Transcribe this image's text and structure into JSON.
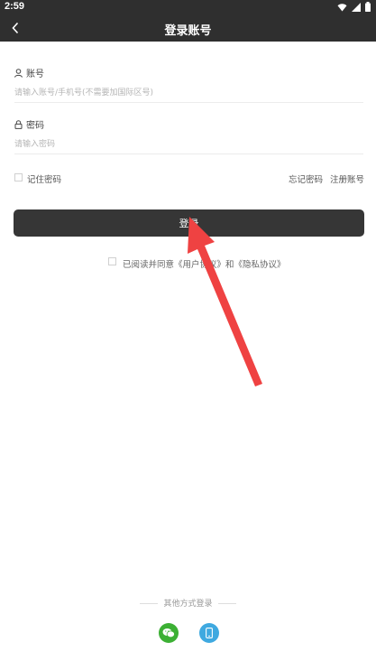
{
  "status_bar": {
    "time": "2:59"
  },
  "header": {
    "title": "登录账号"
  },
  "account": {
    "label": "账号",
    "placeholder": "请输入账号/手机号(不需要加国际区号)"
  },
  "password": {
    "label": "密码",
    "placeholder": "请输入密码"
  },
  "options": {
    "remember_label": "记住密码",
    "forgot_label": "忘记密码",
    "register_label": "注册账号"
  },
  "login_button": {
    "label": "登录"
  },
  "agreement": {
    "text": "已阅读并同意《用户协议》和《隐私协议》"
  },
  "other_login": {
    "label": "其他方式登录"
  },
  "colors": {
    "header_bg": "#2f2f2f",
    "button_bg": "#363636",
    "arrow": "#ef4242",
    "wechat": "#3cb034",
    "phone": "#3fa9e0"
  }
}
